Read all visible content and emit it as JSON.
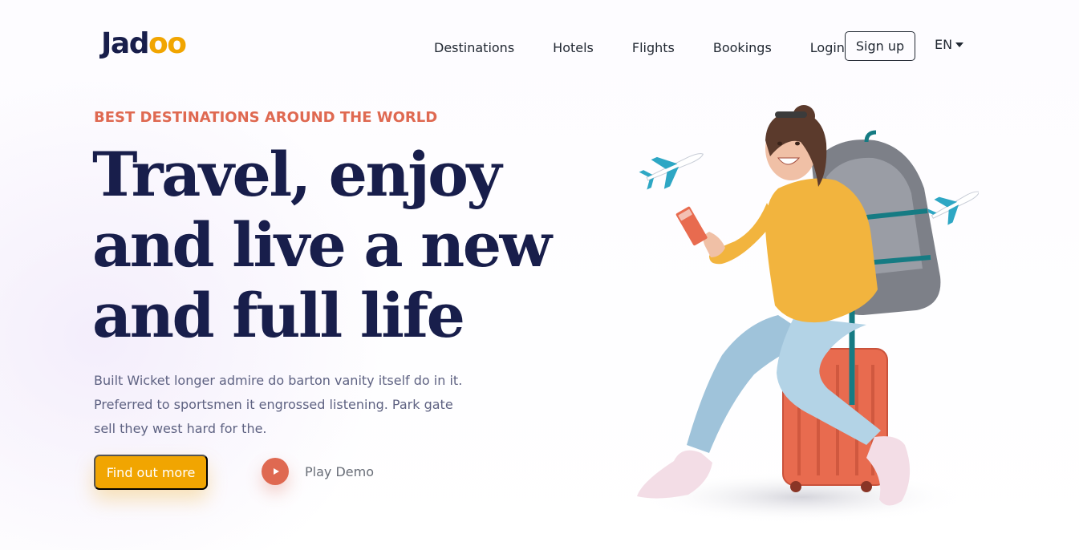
{
  "brand": {
    "logo_prefix": "Jad",
    "logo_suffix": "oo"
  },
  "nav": {
    "links": [
      "Destinations",
      "Hotels",
      "Flights",
      "Bookings",
      "Login"
    ],
    "signup_label": "Sign up",
    "language": "EN"
  },
  "hero": {
    "eyebrow": "BEST DESTINATIONS AROUND THE WORLD",
    "headline_lines": [
      "Travel, enjoy",
      "and live a new",
      "and full life"
    ],
    "description_lines": [
      "Built Wicket longer admire do barton vanity itself do in it.",
      "Preferred to sportsmen it engrossed listening. Park gate",
      "sell they west hard for the."
    ],
    "cta_label": "Find out more",
    "play_label": "Play Demo"
  },
  "colors": {
    "accent_yellow": "#f1a501",
    "accent_coral": "#df6951",
    "heading_navy": "#181e4b",
    "body_gray": "#5e6282"
  },
  "icons": [
    "play-icon",
    "caret-down-icon",
    "airplane-icon"
  ]
}
